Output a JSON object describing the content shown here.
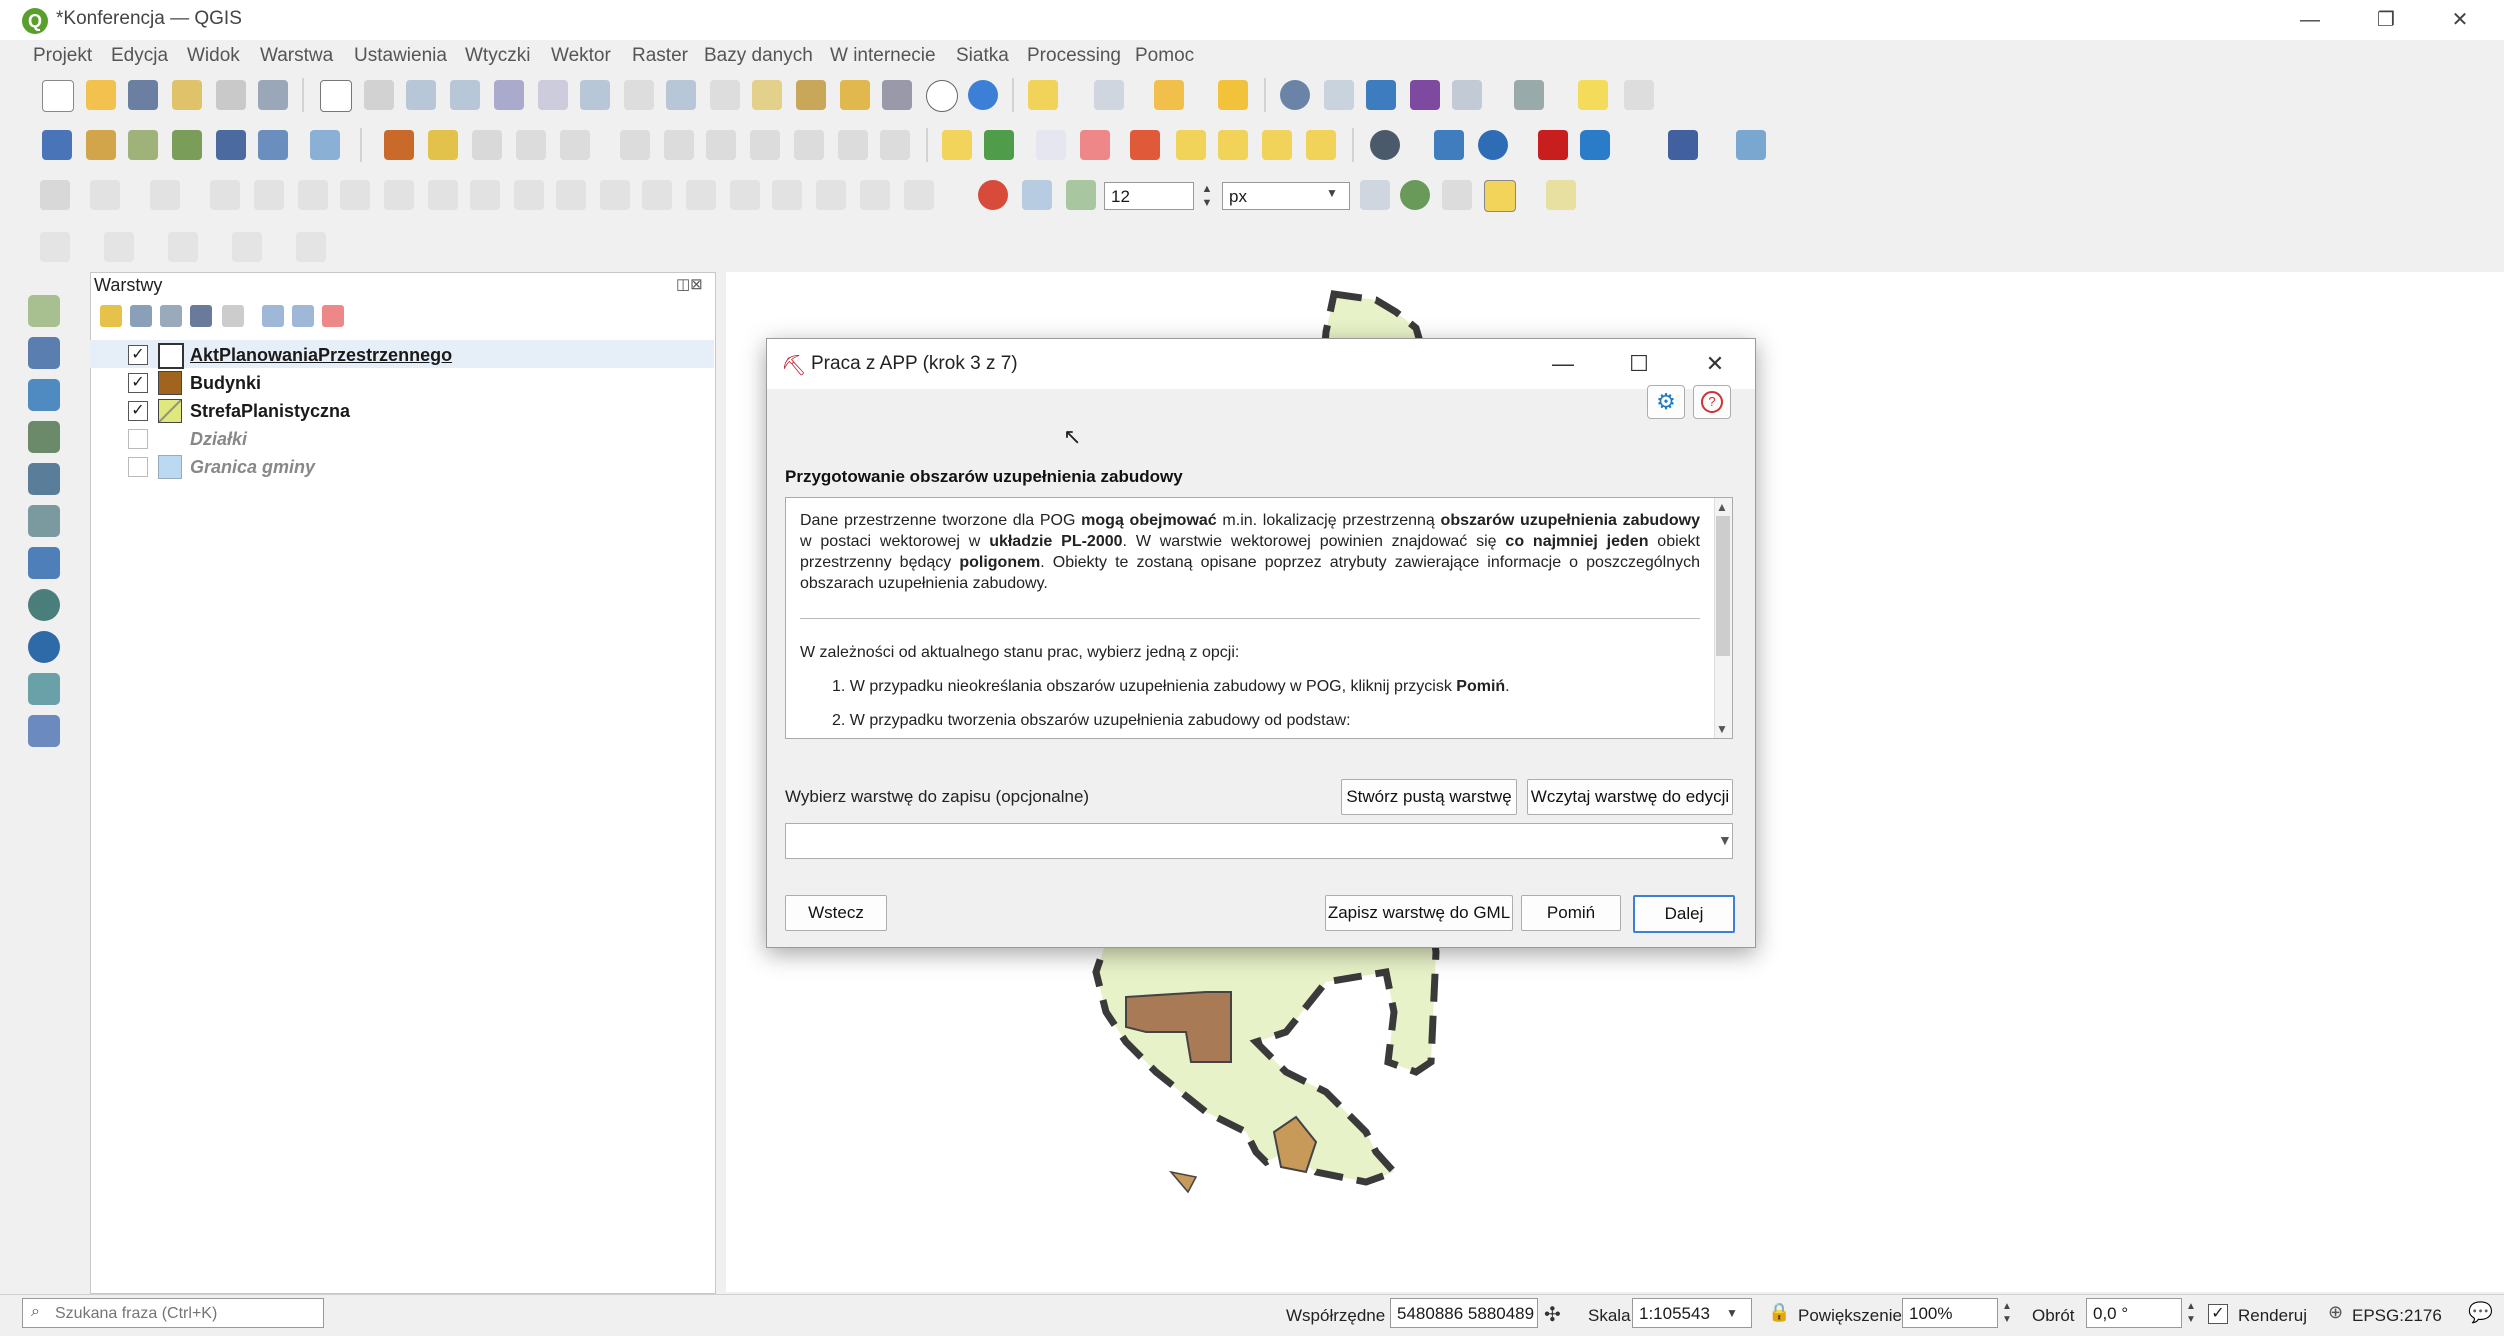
{
  "window": {
    "title": "*Konferencja — QGIS",
    "logo_letter": "Q",
    "controls": {
      "minimize": "—",
      "restore": "❐",
      "close": "✕"
    }
  },
  "menubar": {
    "items": [
      "Projekt",
      "Edycja",
      "Widok",
      "Warstwa",
      "Ustawienia",
      "Wtyczki",
      "Wektor",
      "Raster",
      "Bazy danych",
      "W internecie",
      "Siatka",
      "Processing",
      "Pomoc"
    ]
  },
  "digitizing": {
    "tolerance_value": "12",
    "tolerance_unit": "px"
  },
  "layers_panel": {
    "title": "Warstwy",
    "panel_controls": "◫⊠",
    "layers": [
      {
        "name": "AktPlanowaniaPrzestrzennego",
        "checked": "✓",
        "color": "#ffffff"
      },
      {
        "name": "Budynki",
        "checked": "✓",
        "color": "#a0641e"
      },
      {
        "name": "StrefaPlanistyczna",
        "checked": "✓",
        "color": "#dfe87a"
      },
      {
        "name": "Działki",
        "checked": "",
        "color": "#ffffff"
      },
      {
        "name": "Granica gminy",
        "checked": "",
        "color": "#bcd9f2"
      }
    ]
  },
  "dialog": {
    "title": "Praca z APP (krok 3 z 7)",
    "controls": {
      "minimize": "—",
      "maximize": "☐",
      "close": "✕"
    },
    "heading": "Przygotowanie obszarów uzupełnienia zabudowy",
    "text": {
      "p1_a": "Dane przestrzenne tworzone dla POG ",
      "p1_b": "mogą obejmować",
      "p1_c": " m.in. lokalizację przestrzenną ",
      "p1_d": "obszarów uzupełnienia zabudowy",
      "p1_e": " w postaci wektorowej w ",
      "p1_f": "układzie PL-2000",
      "p1_g": ". W warstwie wektorowej powinien znajdować się ",
      "p1_h": "co najmniej jeden",
      "p1_i": " obiekt przestrzenny będący ",
      "p1_j": "poligonem",
      "p1_k": ". Obiekty te zostaną opisane poprzez atrybuty zawierające informacje o poszczególnych obszarach uzupełnienia zabudowy.",
      "p2": "W zależności od aktualnego stanu prac, wybierz jedną z opcji:",
      "opt1_a": "1. W przypadku nieokreślania obszarów uzupełnienia zabudowy w POG, kliknij przycisk ",
      "opt1_b": "Pomiń",
      "opt1_c": ".",
      "opt2": "2. W przypadku tworzenia obszarów uzupełnienia zabudowy od podstaw:"
    },
    "select_label": "Wybierz warstwę do zapisu (opcjonalne)",
    "btn_create_empty": "Stwórz pustą warstwę",
    "btn_load_layer": "Wczytaj warstwę do edycji",
    "combo_value": "",
    "btn_back": "Wstecz",
    "btn_save_gml": "Zapisz warstwę do GML",
    "btn_skip": "Pomiń",
    "btn_next": "Dalej"
  },
  "statusbar": {
    "search_placeholder": "Szukana fraza (Ctrl+K)",
    "coords_label": "Współrzędne",
    "coords_value": "5480886 5880489",
    "scale_label": "Skala",
    "scale_value": "1:105543",
    "magnifier_label": "Powiększenie",
    "magnifier_value": "100%",
    "rotation_label": "Obrót",
    "rotation_value": "0,0 °",
    "render_label": "Renderuj",
    "render_checked": "✓",
    "crs": "EPSG:2176"
  },
  "colors": {
    "accent": "#3b7fd6",
    "map_fill": "#e8f2c8",
    "map_boundary": "#3a3a3a",
    "zone_red": "#ef5a4a",
    "zone_yellow": "#f5dd4a",
    "buildings": "#a87a55"
  }
}
